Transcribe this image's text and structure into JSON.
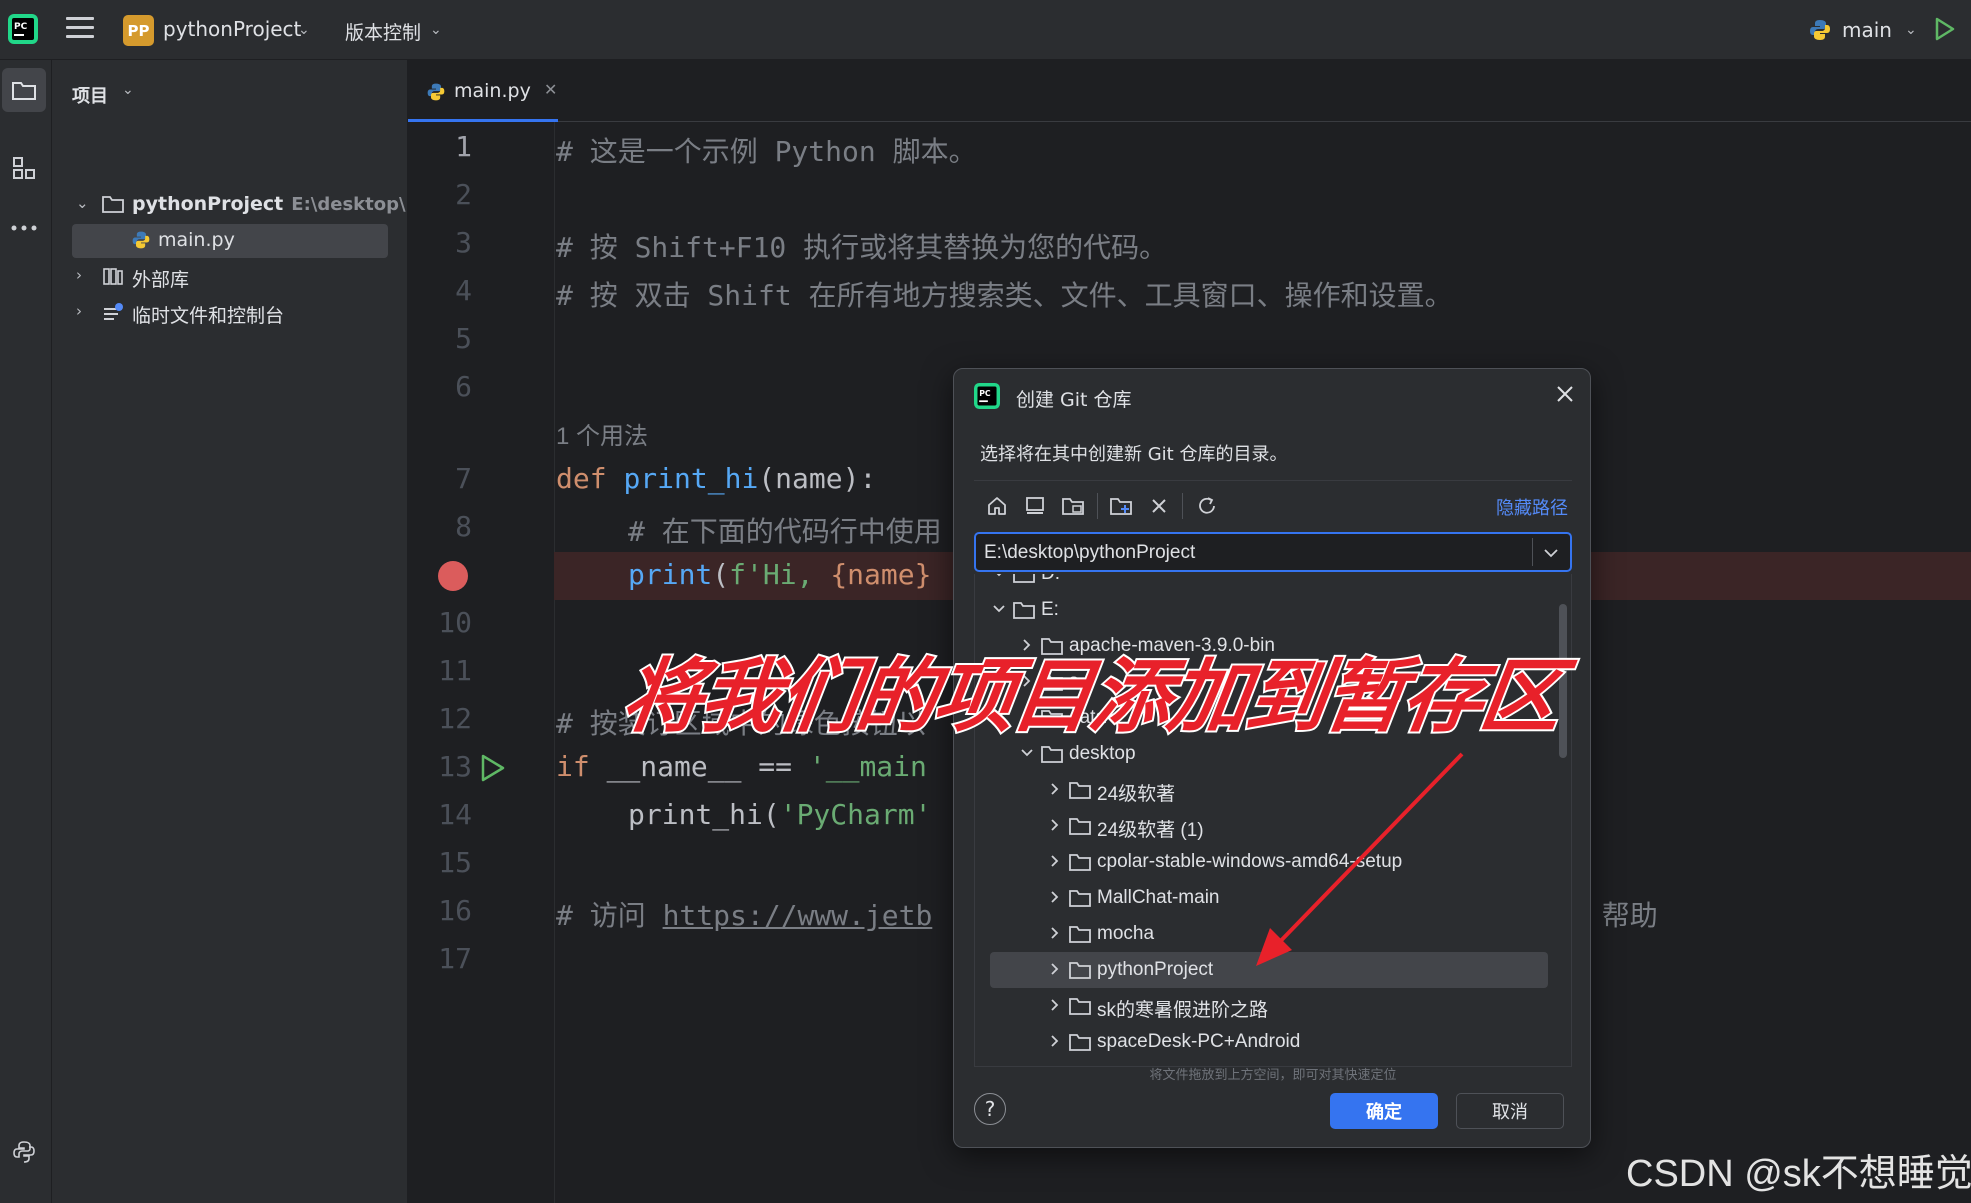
{
  "titlebar": {
    "project_badge": "PP",
    "project_name": "pythonProject",
    "vcs_label": "版本控制",
    "branch": "main"
  },
  "project_panel": {
    "header": "项目",
    "tree": [
      {
        "label": "pythonProject",
        "sub": "E:\\desktop\\py",
        "bold": true
      },
      {
        "label": "main.py"
      },
      {
        "label": "外部库"
      },
      {
        "label": "临时文件和控制台"
      }
    ]
  },
  "editor": {
    "tab_label": "main.py",
    "usage_hint": "1 个用法",
    "line_numbers": [
      "1",
      "2",
      "3",
      "4",
      "5",
      "6",
      "7",
      "8",
      "",
      "10",
      "11",
      "12",
      "13",
      "14",
      "15",
      "16",
      "17"
    ],
    "lines": {
      "l1": "# 这是一个示例 Python 脚本。",
      "l3": "# 按 Shift+F10 执行或将其替换为您的代码。",
      "l4": "# 按 双击 Shift 在所有地方搜索类、文件、工具窗口、操作和设置。",
      "l7_kw": "def",
      "l7_fn": "print_hi",
      "l7_rest": "(name):",
      "l8": "# 在下面的代码行中使用",
      "l9_fn": "print",
      "l9_open": "(",
      "l9_str": "f'Hi, ",
      "l9_brace": "{name}",
      "l12": "# 按装订区域中的绿色按钮以",
      "l13_kw": "if",
      "l13_rest": " __name__ == ",
      "l13_str": "'__main",
      "l14_fn": "print_hi(",
      "l14_str": "'PyCharm'",
      "l16_a": "# 访问 ",
      "l16_link": "https://www.jetb",
      "l16_b": "n 帮助"
    }
  },
  "dialog": {
    "title": "创建 Git 仓库",
    "description": "选择将在其中创建新 Git 仓库的目录。",
    "hide_path": "隐藏路径",
    "path_value": "E:\\desktop\\pythonProject",
    "tree": [
      {
        "label": "D:"
      },
      {
        "label": "E:"
      },
      {
        "label": "apache-maven-3.9.0-bin"
      },
      {
        "label": "s"
      },
      {
        "label": "data"
      },
      {
        "label": "desktop"
      },
      {
        "label": "24级软著"
      },
      {
        "label": "24级软著 (1)"
      },
      {
        "label": "cpolar-stable-windows-amd64-setup"
      },
      {
        "label": "MallChat-main"
      },
      {
        "label": "mocha"
      },
      {
        "label": "pythonProject"
      },
      {
        "label": "sk的寒暑假进阶之路"
      },
      {
        "label": "spaceDesk-PC+Android"
      }
    ],
    "drop_hint": "将文件拖放到上方空间，即可对其快速定位",
    "help_label": "?",
    "ok_label": "确定",
    "cancel_label": "取消"
  },
  "overlay": {
    "banner": "将我们的项目添加到暂存区",
    "watermark": "CSDN @sk不想睡觉"
  },
  "colors": {
    "accent": "#3574f0",
    "banner_red": "#e8212a",
    "breakpoint": "#db5c5c",
    "arrow": "#e8212a"
  },
  "icons": [
    "pycharm-icon",
    "hamburger-menu-icon",
    "python-icon",
    "run-icon",
    "folder-icon",
    "structure-icon",
    "more-icon",
    "python-console-icon",
    "library-icon",
    "scratches-icon",
    "home-icon",
    "desktop-icon",
    "project-folder-icon",
    "new-folder-icon",
    "delete-icon",
    "refresh-icon",
    "close-icon",
    "chevron-down-icon",
    "chevron-right-icon"
  ]
}
